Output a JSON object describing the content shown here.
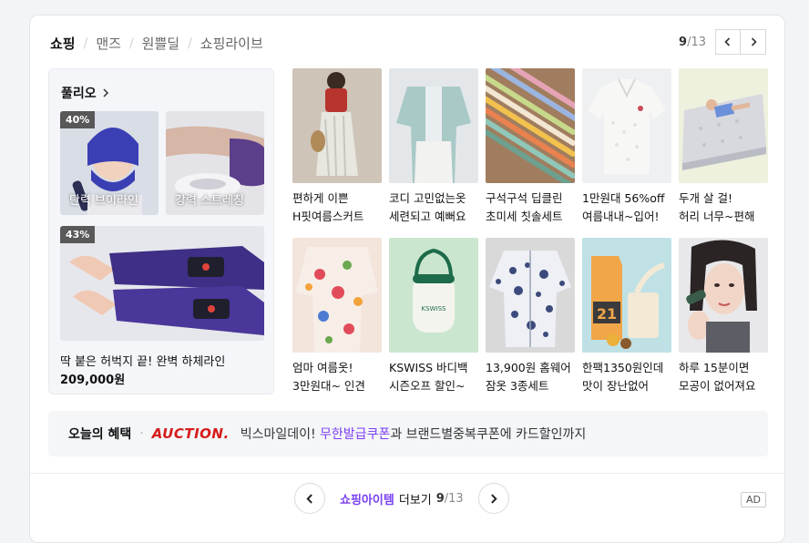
{
  "tabs": [
    {
      "label": "쇼핑",
      "active": true
    },
    {
      "label": "맨즈",
      "active": false
    },
    {
      "label": "원쁠딜",
      "active": false
    },
    {
      "label": "쇼핑라이브",
      "active": false
    }
  ],
  "pager": {
    "current": "9",
    "total": "/13"
  },
  "feature": {
    "brand": "풀리오",
    "thumb1": {
      "discount": "40%",
      "label": "탄력 브이라인"
    },
    "thumb2": {
      "label": "강력 스트레칭"
    },
    "thumb3": {
      "discount": "43%"
    },
    "title": "딱 붙은 허벅지 끝! 완벽 하체라인",
    "price": "209,000원"
  },
  "products": [
    {
      "line1": "편하게 이쁜",
      "line2": "H핏여름스커트",
      "icon": "long-skirt-photo"
    },
    {
      "line1": "코디 고민없는옷",
      "line2": "세련되고 예뻐요",
      "icon": "shirt-set-photo"
    },
    {
      "line1": "구석구석 딥클린",
      "line2": "초미세 칫솔세트",
      "icon": "toothbrush-photo"
    },
    {
      "line1": "1만원대 56%off",
      "line2": "여름내내~입어!",
      "icon": "knit-top-photo"
    },
    {
      "line1": "두개 살 걸!",
      "line2": "허리 너무~편해",
      "icon": "mattress-photo"
    },
    {
      "line1": "엄마 여름옷!",
      "line2": "3만원대~ 인견",
      "icon": "floral-blouse-photo"
    },
    {
      "line1": "KSWISS 바디백",
      "line2": "시즌오프 할인~",
      "icon": "body-bag-photo"
    },
    {
      "line1": "13,900원 홈웨어",
      "line2": "잠옷 3종세트",
      "icon": "pajama-photo"
    },
    {
      "line1": "한팩1350원인데",
      "line2": "맛이 장난없어",
      "icon": "protein-drink-photo"
    },
    {
      "line1": "하루 15분이면",
      "line2": "모공이 없어져요",
      "icon": "beauty-device-photo"
    }
  ],
  "benefit": {
    "label": "오늘의 혜택",
    "logo": "AUCTION.",
    "text_before": "빅스마일데이!",
    "link": "무한발급쿠폰",
    "text_after": "과 브랜드별중복쿠폰에 카드할인까지"
  },
  "footer": {
    "more_label": "쇼핑아이템",
    "more_suffix": "더보기",
    "current": "9",
    "total": "/13",
    "ad": "AD"
  },
  "colors": {
    "accent": "#7b3ff2",
    "auction_red": "#d71b1b"
  }
}
